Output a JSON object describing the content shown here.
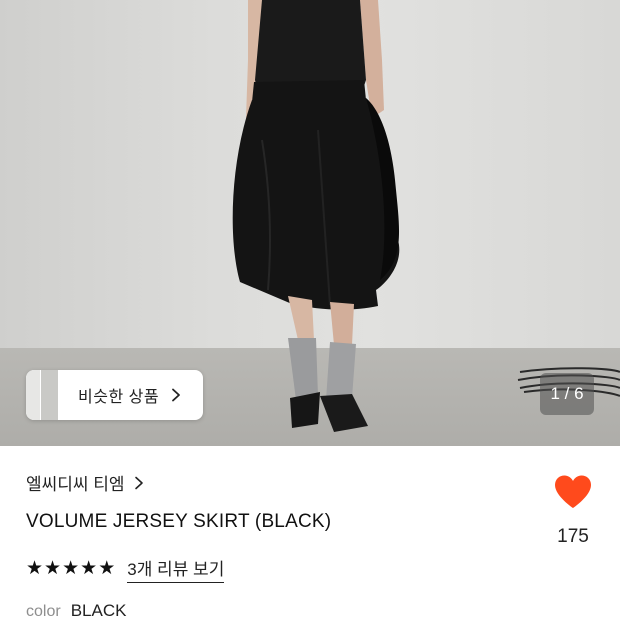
{
  "gallery": {
    "similar_label": "비슷한 상품",
    "counter": "1 / 6"
  },
  "product": {
    "brand": "엘씨디씨 티엠",
    "title": "VOLUME JERSEY SKIRT (BLACK)",
    "rating": 5,
    "stars": [
      "★",
      "★",
      "★",
      "★",
      "★"
    ],
    "review_link": "3개 리뷰 보기",
    "color_label": "color",
    "color_value": "BLACK"
  },
  "like": {
    "count": "175",
    "color": "#ff4a1c"
  },
  "icons": {
    "similar_chevron": "chevron-right-icon",
    "brand_chevron": "chevron-right-icon",
    "like": "heart-icon",
    "rating": "star-icon"
  }
}
